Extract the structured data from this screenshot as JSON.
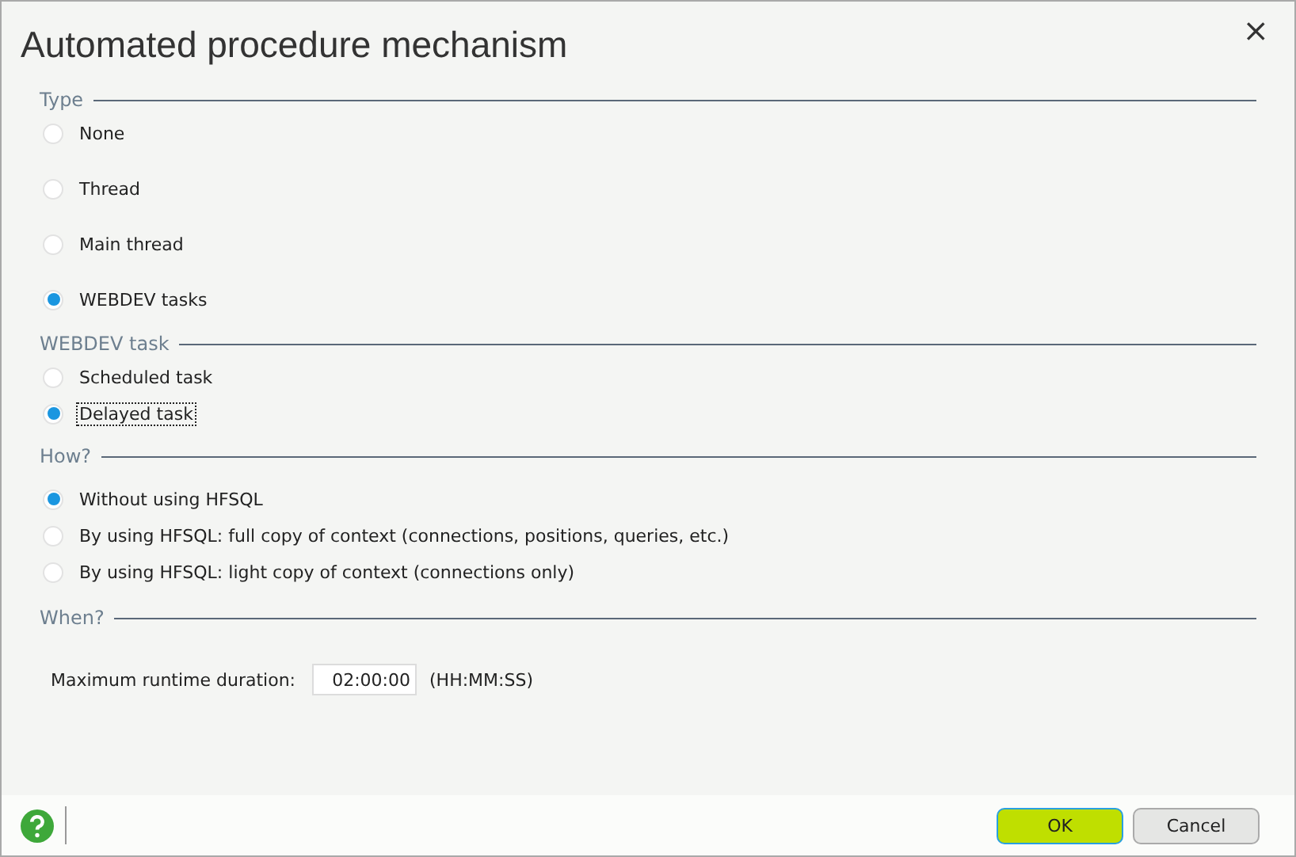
{
  "window": {
    "title": "Automated procedure mechanism",
    "close": "×"
  },
  "sections": [
    {
      "kind": "radios",
      "title": "Type",
      "options": [
        {
          "label": "None",
          "selected": false,
          "focused": false
        },
        {
          "label": "Thread",
          "selected": false,
          "focused": false
        },
        {
          "label": "Main thread",
          "selected": false,
          "focused": false
        },
        {
          "label": "WEBDEV tasks",
          "selected": true,
          "focused": false
        }
      ]
    },
    {
      "kind": "radios",
      "title": "WEBDEV task",
      "options": [
        {
          "label": "Scheduled task",
          "selected": false,
          "focused": false
        },
        {
          "label": "Delayed task",
          "selected": true,
          "focused": true
        }
      ]
    },
    {
      "kind": "radios",
      "title": "How?",
      "options": [
        {
          "label": "Without using HFSQL",
          "selected": true,
          "focused": false
        },
        {
          "label": "By using HFSQL: full copy of context (connections, positions, queries, etc.)",
          "selected": false,
          "focused": false
        },
        {
          "label": "By using HFSQL: light copy of context (connections only)",
          "selected": false,
          "focused": false
        }
      ]
    },
    {
      "kind": "duration",
      "title": "When?",
      "label": "Maximum runtime duration:",
      "value": "02:00:00",
      "format": "(HH:MM:SS)"
    }
  ],
  "buttons": [
    {
      "label": "OK",
      "primary": true
    },
    {
      "label": "Cancel",
      "primary": false
    }
  ]
}
